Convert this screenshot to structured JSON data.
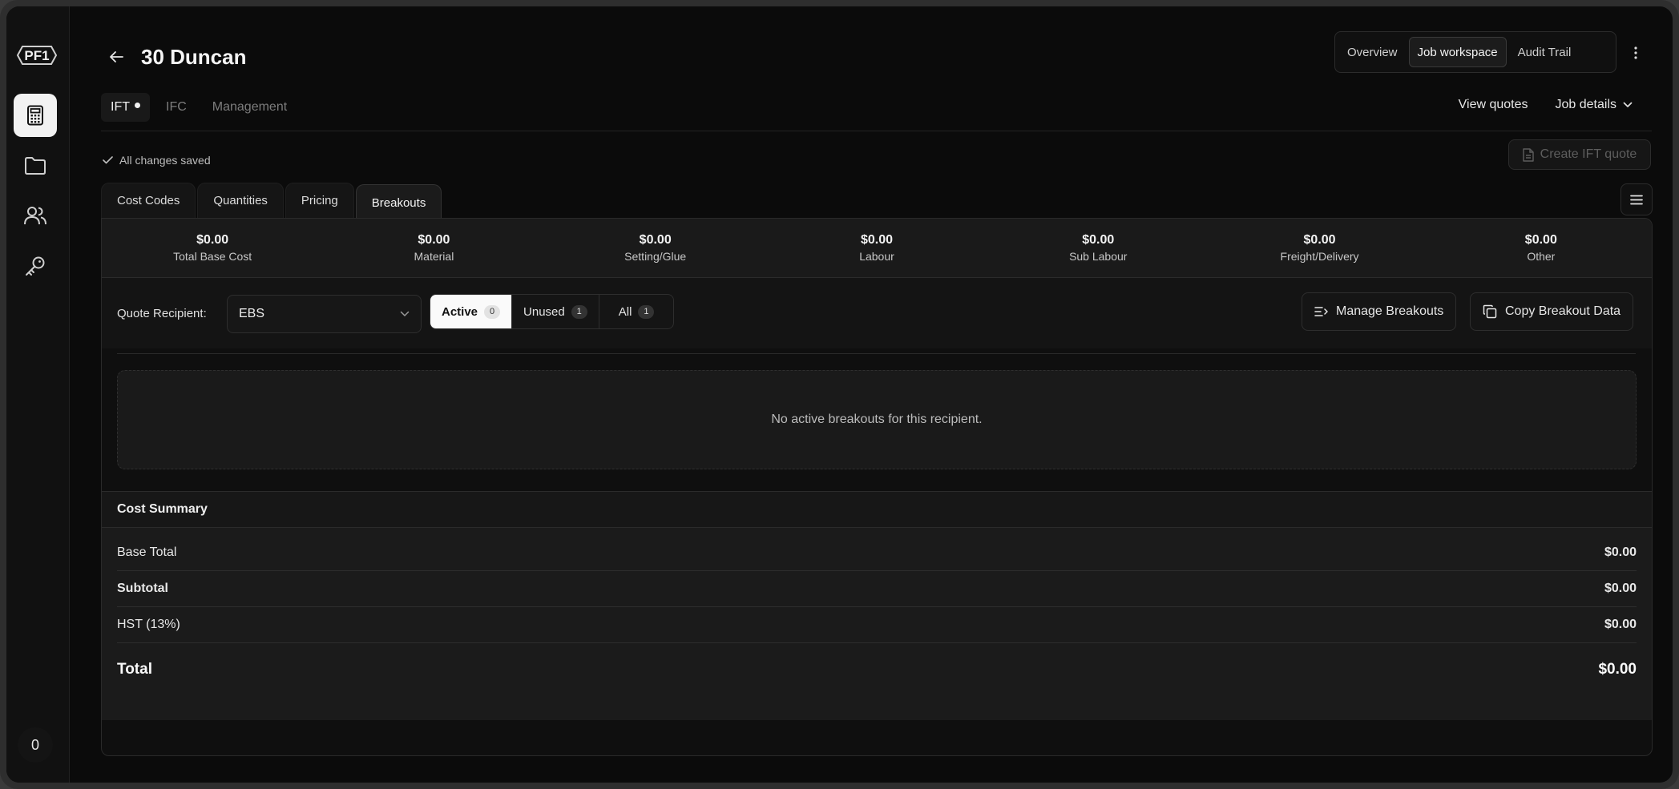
{
  "app": {
    "logo_text": "PF1",
    "notification_count": "0"
  },
  "header": {
    "title": "30 Duncan",
    "views": [
      {
        "label": "Overview"
      },
      {
        "label": "Job workspace"
      },
      {
        "label": "Audit Trail"
      }
    ]
  },
  "phases": [
    {
      "label": "IFT"
    },
    {
      "label": "IFC"
    },
    {
      "label": "Management"
    }
  ],
  "links": {
    "view_quotes": "View quotes",
    "job_details": "Job details"
  },
  "status": {
    "saved": "All changes saved"
  },
  "actions": {
    "create_quote": "Create IFT quote",
    "manage_breakouts": "Manage Breakouts",
    "copy_breakout": "Copy Breakout Data"
  },
  "tabs": [
    {
      "label": "Cost Codes"
    },
    {
      "label": "Quantities"
    },
    {
      "label": "Pricing"
    },
    {
      "label": "Breakouts"
    }
  ],
  "stats": [
    {
      "value": "$0.00",
      "label": "Total Base Cost"
    },
    {
      "value": "$0.00",
      "label": "Material"
    },
    {
      "value": "$0.00",
      "label": "Setting/Glue"
    },
    {
      "value": "$0.00",
      "label": "Labour"
    },
    {
      "value": "$0.00",
      "label": "Sub Labour"
    },
    {
      "value": "$0.00",
      "label": "Freight/Delivery"
    },
    {
      "value": "$0.00",
      "label": "Other"
    }
  ],
  "recipient": {
    "label": "Quote Recipient:",
    "value": "EBS"
  },
  "filters": [
    {
      "label": "Active",
      "count": "0"
    },
    {
      "label": "Unused",
      "count": "1"
    },
    {
      "label": "All",
      "count": "1"
    }
  ],
  "empty_message": "No active breakouts for this recipient.",
  "summary": {
    "title": "Cost Summary",
    "rows": [
      {
        "label": "Base Total",
        "value": "$0.00"
      },
      {
        "label": "Subtotal",
        "value": "$0.00"
      },
      {
        "label": "HST (13%)",
        "value": "$0.00"
      },
      {
        "label": "Total",
        "value": "$0.00"
      }
    ]
  },
  "colors": {
    "background": "#0b0b0b",
    "panel": "#1a1a1a",
    "active_tab": "#f2f2f2"
  }
}
